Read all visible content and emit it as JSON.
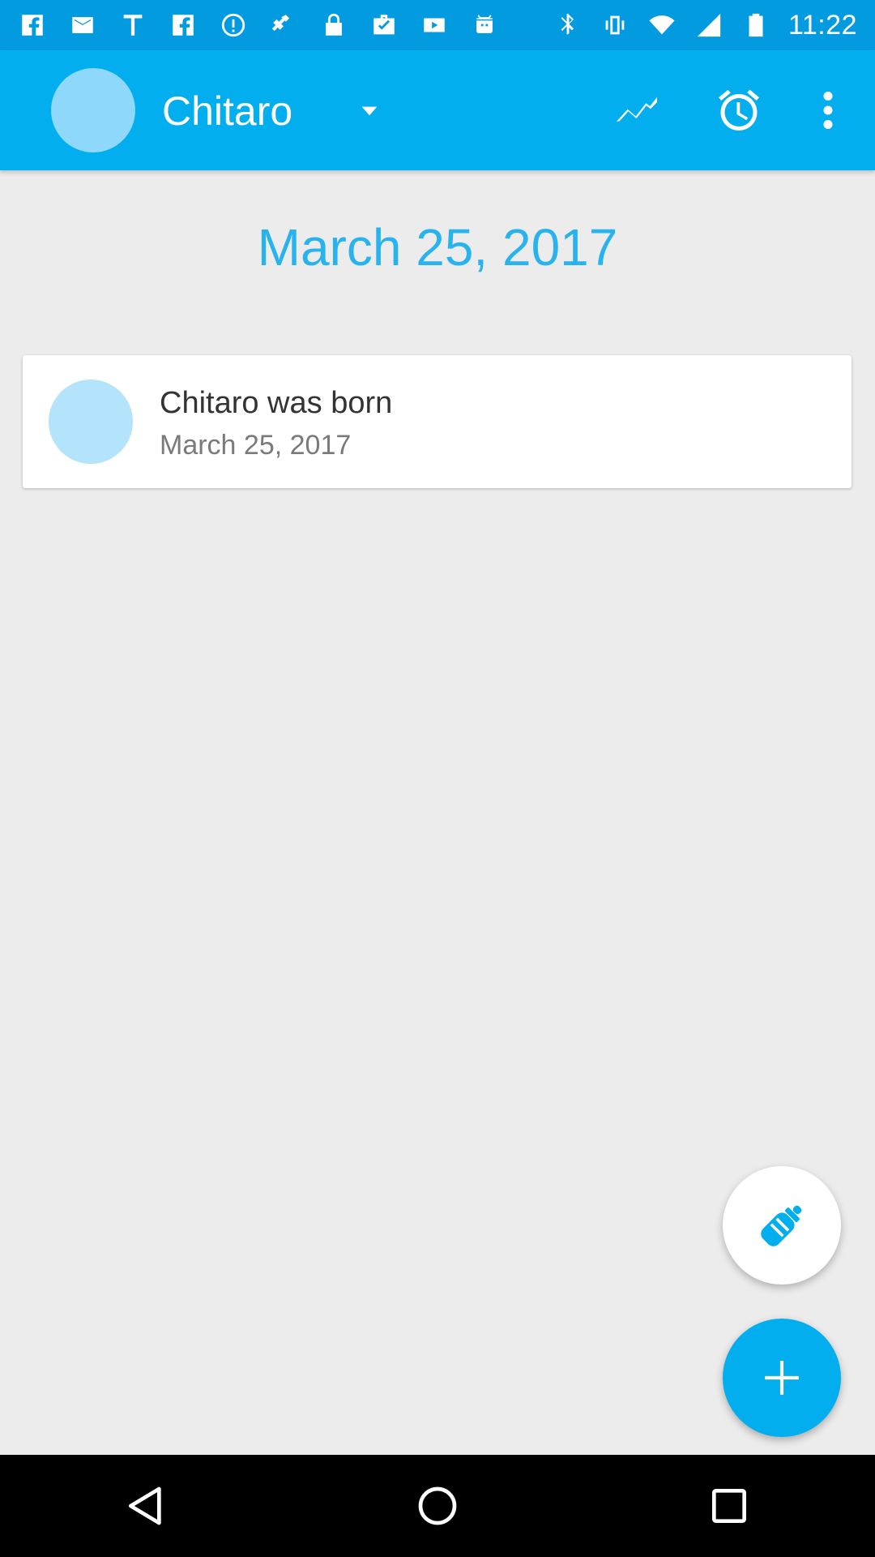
{
  "status_bar": {
    "time": "11:22",
    "icons": [
      "facebook-icon",
      "mail-icon",
      "t-icon",
      "facebook-icon",
      "info-icon",
      "fake-gps-icon",
      "lock-icon",
      "briefcase-check-icon",
      "youtube-icon",
      "android-icon",
      "bluetooth-icon",
      "vibrate-icon",
      "wifi-icon",
      "signal-icon",
      "battery-icon"
    ]
  },
  "appbar": {
    "baby_name": "Chitaro",
    "icons": [
      "growth-chart-icon",
      "alarm-clock-icon",
      "more-vert-icon"
    ],
    "accent": "#03aeee"
  },
  "main": {
    "date_heading": "March 25, 2017",
    "events": [
      {
        "title": "Chitaro was born",
        "date": "March 25, 2017"
      }
    ]
  },
  "fabs": {
    "feed_icon": "baby-bottle-icon",
    "add_icon": "plus-icon"
  },
  "nav": {
    "icons": [
      "back-icon",
      "home-icon",
      "recents-icon"
    ]
  }
}
